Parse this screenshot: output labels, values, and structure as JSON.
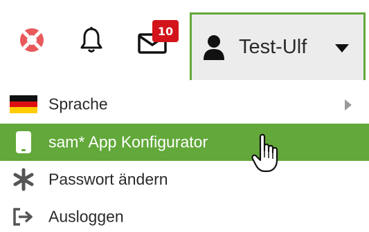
{
  "header": {
    "support_icon": "lifebuoy-icon",
    "notifications_icon": "bell-icon",
    "messages_icon": "envelope-icon",
    "messages_count": "10",
    "user_name": "Test-Ulf",
    "user_icon": "user-icon",
    "dropdown_icon": "caret-down-icon"
  },
  "menu": {
    "items": [
      {
        "label": "Sprache",
        "icon": "german-flag-icon",
        "submenu_icon": "caret-right-icon"
      },
      {
        "label": "sam* App Konfigurator",
        "icon": "mobile-phone-icon",
        "active": true
      },
      {
        "label": "Passwort ändern",
        "icon": "asterisk-icon"
      },
      {
        "label": "Ausloggen",
        "icon": "logout-icon"
      }
    ]
  },
  "colors": {
    "accent_green": "#62a83a",
    "badge_red": "#d3141b",
    "lifebuoy_red": "#e85a5a",
    "button_bg": "#ececec",
    "text": "#2a2a2a"
  }
}
